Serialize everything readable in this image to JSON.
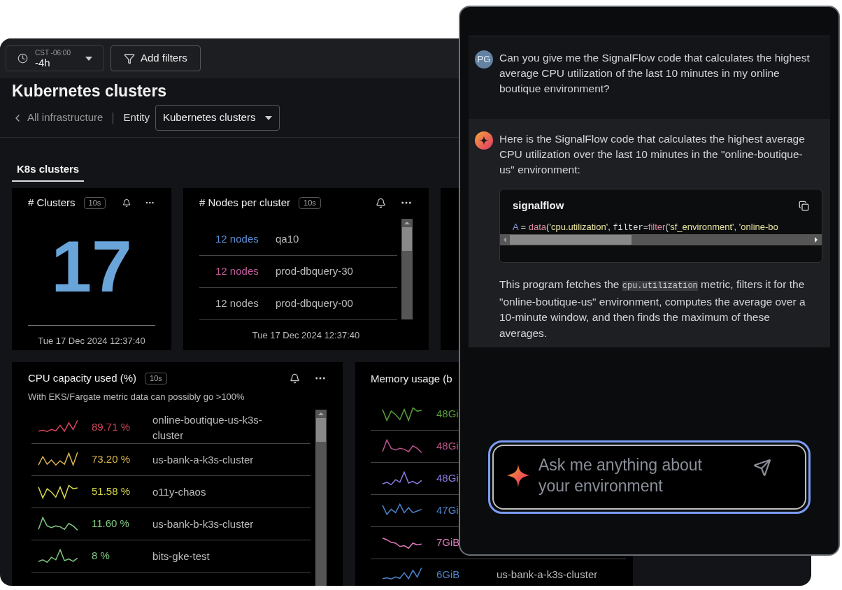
{
  "toolbar": {
    "time_range": {
      "timezone": "CST -06:00",
      "value": "-4h"
    },
    "filter_button": "Add filters"
  },
  "page": {
    "title": "Kubernetes clusters",
    "breadcrumb": {
      "back": "All infrastructure",
      "entity_label": "Entity",
      "entity_value": "Kubernetes clusters"
    }
  },
  "tabs": [
    {
      "label": "K8s clusters",
      "selected": true
    }
  ],
  "tiles": [
    {
      "kind": "single_value",
      "title": "# Clusters",
      "refresh": "10s",
      "value": "17",
      "timestamp": "Tue 17 Dec 2024 12:37:40"
    },
    {
      "kind": "list",
      "title": "# Nodes per cluster",
      "refresh": "10s",
      "timestamp": "Tue 17 Dec 2024 12:37:40",
      "rows": [
        {
          "value": "12 nodes",
          "name": "qa10",
          "color": "#5b8fd6"
        },
        {
          "value": "12 nodes",
          "name": "prod-dbquery-30",
          "color": "#c25c9c"
        },
        {
          "value": "12 nodes",
          "name": "prod-dbquery-00",
          "color": "#b4b4b4"
        }
      ]
    },
    {
      "kind": "blank"
    }
  ],
  "cpu_card": {
    "title": "CPU capacity used (%)",
    "refresh": "10s",
    "subtitle": "With EKS/Fargate metric data can possibly go >100%",
    "rows": [
      {
        "value": "89.71 %",
        "name": "online-boutique-us-k3s-cluster",
        "color": "#d3455c"
      },
      {
        "value": "73.20 %",
        "name": "us-bank-a-k3s-cluster",
        "color": "#dcb44e"
      },
      {
        "value": "51.58 %",
        "name": "o11y-chaos",
        "color": "#d9d94a"
      },
      {
        "value": "11.60 %",
        "name": "us-bank-b-k3s-cluster",
        "color": "#80c880"
      },
      {
        "value": "8 %",
        "name": "bits-gke-test",
        "color": "#80c880"
      }
    ]
  },
  "memory_card": {
    "title": "Memory usage (b",
    "rows": [
      {
        "value": "48Gi",
        "color": "#5c9e3c"
      },
      {
        "value": "48Gi",
        "color": "#b8548c"
      },
      {
        "value": "48Gi",
        "color": "#8c7ce2"
      },
      {
        "value": "47Gi",
        "color": "#4c84ca"
      },
      {
        "value": "7GiB",
        "color": "#e07cba"
      },
      {
        "value": "6GiB",
        "name": "us-bank-a-k3s-cluster",
        "color": "#4c84ca"
      }
    ]
  },
  "chat": {
    "messages": [
      {
        "kind": "user",
        "avatar": "PG",
        "text": "Can you give me the SignalFlow code that calculates the highest average CPU utilization of the last 10 minutes in my online boutique environment?"
      },
      {
        "kind": "assistant",
        "text": "Here is the SignalFlow code that calculates the highest average CPU utilization over the last 10 minutes in the \"online-boutique-us\" environment:",
        "code_block": {
          "language": "signalflow",
          "tokens": [
            {
              "text": "A",
              "kind": "variable"
            },
            {
              "text": " = ",
              "kind": "operator"
            },
            {
              "text": "data",
              "kind": "function"
            },
            {
              "text": "(",
              "kind": "punct"
            },
            {
              "text": "'cpu.utilization'",
              "kind": "string"
            },
            {
              "text": ", ",
              "kind": "punct"
            },
            {
              "text": "filter=",
              "kind": "keyword"
            },
            {
              "text": "filter",
              "kind": "function"
            },
            {
              "text": "(",
              "kind": "punct"
            },
            {
              "text": "'sf_environment'",
              "kind": "string"
            },
            {
              "text": ", ",
              "kind": "punct"
            },
            {
              "text": "'online-bo",
              "kind": "string"
            }
          ]
        },
        "summary": {
          "before": "This program fetches the",
          "code": "cpu.utilization",
          "after": "metric, filters it for the \"online-boutique-us\" environment, computes the average over a 10-minute window, and then finds the maximum of these averages."
        }
      }
    ],
    "input": {
      "placeholder": "Ask me anything about your environment"
    }
  }
}
